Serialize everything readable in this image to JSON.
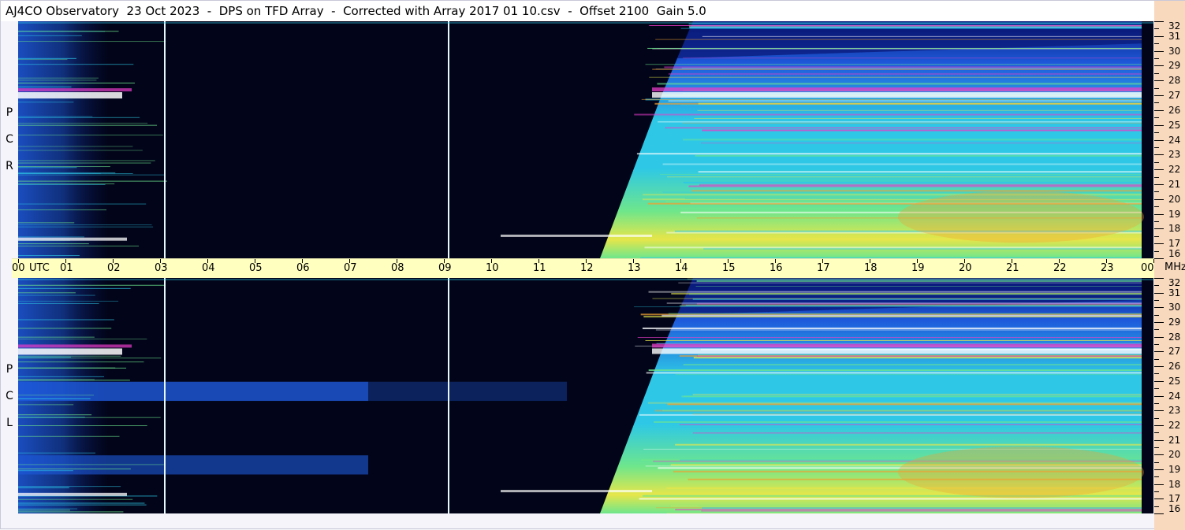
{
  "title": "AJ4CO Observatory  23 Oct 2023  -  DPS on TFD Array  -  Corrected with Array 2017 01 10.csv  -  Offset 2100  Gain 5.0",
  "colors": {
    "background": "#02051a",
    "deep_blue": "#0a1a7a",
    "blue": "#1e5adc",
    "cyan": "#2ec8e6",
    "green": "#6ee68c",
    "yellow": "#e6e64a",
    "orange": "#f0a030",
    "magenta": "#e83cc8",
    "white": "#ffffff",
    "axis_band": "#ffffc0",
    "freq_strip": "#f9d9bd"
  },
  "chart_data": {
    "type": "heatmap",
    "title": "AJ4CO Observatory  23 Oct 2023  -  DPS on TFD Array  -  Corrected with Array 2017 01 10.csv  -  Offset 2100  Gain 5.0",
    "xlabel": "UTC",
    "ylabel": "MHz",
    "x_unit": "UTC",
    "y_unit": "MHz",
    "xlim": [
      0,
      24
    ],
    "ylim": [
      16,
      32
    ],
    "x_ticks": [
      "00",
      "01",
      "02",
      "03",
      "04",
      "05",
      "06",
      "07",
      "08",
      "09",
      "10",
      "11",
      "12",
      "13",
      "14",
      "15",
      "16",
      "17",
      "18",
      "19",
      "20",
      "21",
      "22",
      "23",
      "00"
    ],
    "y_ticks": [
      "16",
      "17",
      "18",
      "19",
      "20",
      "21",
      "22",
      "23",
      "24",
      "25",
      "26",
      "27",
      "28",
      "29",
      "30",
      "31",
      "32"
    ],
    "panels": [
      {
        "name": "RCP",
        "letters": [
          "P",
          "C",
          "R"
        ],
        "bright_start_utc": [
          13.6,
          12.3
        ],
        "persistent_band_mhz": 27,
        "night_features": []
      },
      {
        "name": "LCP",
        "letters": [
          "P",
          "C",
          "L"
        ],
        "bright_start_utc": [
          13.6,
          12.3
        ],
        "persistent_band_mhz": 27,
        "night_features": [
          {
            "from_utc": 0,
            "to_utc": 7.4,
            "mhz": 24.3,
            "intensity": 0.8
          },
          {
            "from_utc": 0,
            "to_utc": 7.4,
            "mhz": 19.3,
            "intensity": 0.6
          },
          {
            "from_utc": 7.4,
            "to_utc": 11.6,
            "mhz": 24.3,
            "intensity": 0.35
          }
        ]
      }
    ],
    "marker_lines_utc": [
      3.1,
      9.1
    ]
  }
}
